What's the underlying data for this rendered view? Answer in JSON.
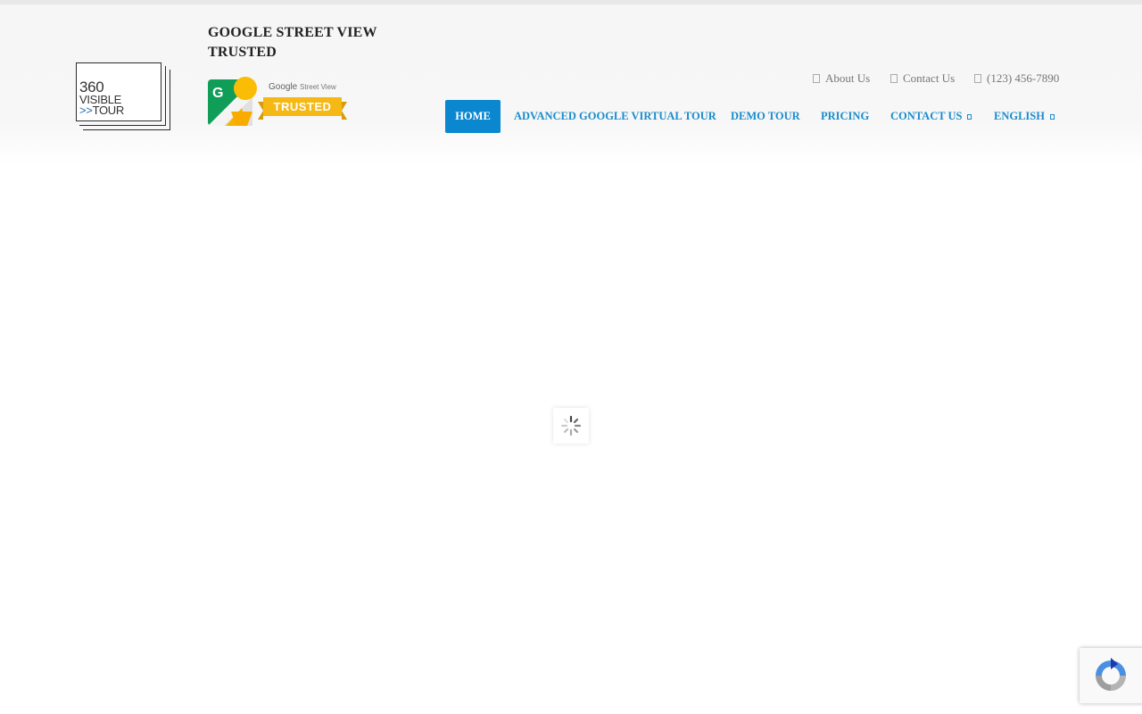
{
  "logo": {
    "line1": "360",
    "line2": "VISIBLE",
    "line3_arrows": ">>",
    "line3_text": "TOUR"
  },
  "trusted": {
    "title": "GOOGLE STREET VIEW TRUSTED",
    "badge_google": "Google",
    "badge_streetview": "Street View",
    "badge_ribbon": "TRUSTED"
  },
  "utility_links": {
    "about": "About Us",
    "contact": "Contact Us",
    "phone": "(123) 456-7890"
  },
  "nav": {
    "home": "HOME",
    "advanced": "ADVANCED GOOGLE VIRTUAL TOUR",
    "demo": "DEMO TOUR",
    "pricing": "PRICING",
    "contact": "CONTACT US",
    "english": "ENGLISH"
  },
  "colors": {
    "nav_active_bg": "#0a87cf",
    "nav_link": "#1a8ccc",
    "ribbon": "#f5b815"
  }
}
